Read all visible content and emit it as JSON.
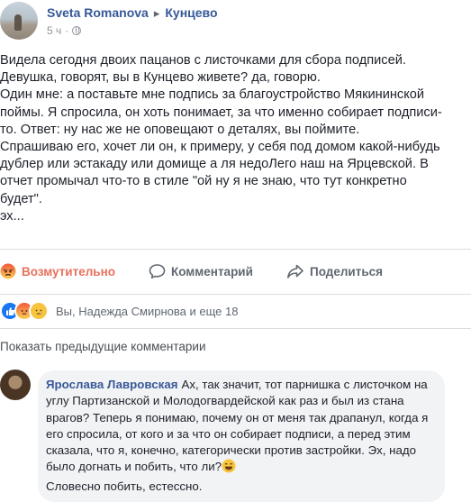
{
  "post": {
    "author": "Sveta Romanova",
    "arrow": "▸",
    "destination": "Кунцево",
    "time": "5 ч",
    "separator": "·",
    "privacy_icon": "globe-icon",
    "lines": [
      "Видела сегодня двоих пацанов с листочками для сбора подписей.",
      "Девушка, говорят, вы в Кунцево живете? да, говорю.",
      "Один мне: а поставьте мне подпись за благоустройство Мякининской",
      "поймы. Я спросила, он хоть понимает, за что именно собирает подписи-",
      "то. Ответ: ну нас же не оповещают о деталях, вы поймите.",
      "Спрашиваю его, хочет ли он, к примеру, у себя под домом какой-нибудь",
      "дублер или эстакаду или домище а ля недоЛего наш на Ярцевской. В",
      "отчет промычал что-то в стиле \"ой ну я не знаю, что тут конкретно",
      "будет\".",
      "эх..."
    ]
  },
  "actions": {
    "reaction_label": "Возмутительно",
    "comment_label": "Комментарий",
    "share_label": "Поделиться"
  },
  "reactions": {
    "icons": [
      "like-reaction-icon",
      "angry-reaction-icon",
      "sad-reaction-icon"
    ],
    "summary": "Вы, Надежда Смирнова и еще 18"
  },
  "comments": {
    "previous_link": "Показать предыдущие комментарии",
    "items": [
      {
        "author": "Ярослава Лавровская",
        "text_before_emoji": "Ах, так значит, тот парнишка с листочком на углу Партизанской и Молодогвардейской как раз и был из стана врагов? Теперь я понимаю, почему он от меня так драпанул, когда я его спросила, от кого и за что он собирает подписи, а перед этим сказала, что я, конечно, категорически против застройки. Эх, надо было догнать и побить, что ли?",
        "emoji": "laughing-emoji-icon",
        "text_after_emoji": "Словесно побить, естессно."
      }
    ]
  },
  "colors": {
    "link_blue": "#365899",
    "angry_orange": "#e8715c",
    "muted_gray": "#606770",
    "bubble_bg": "#f2f3f5",
    "like_blue": "#1877f2"
  }
}
